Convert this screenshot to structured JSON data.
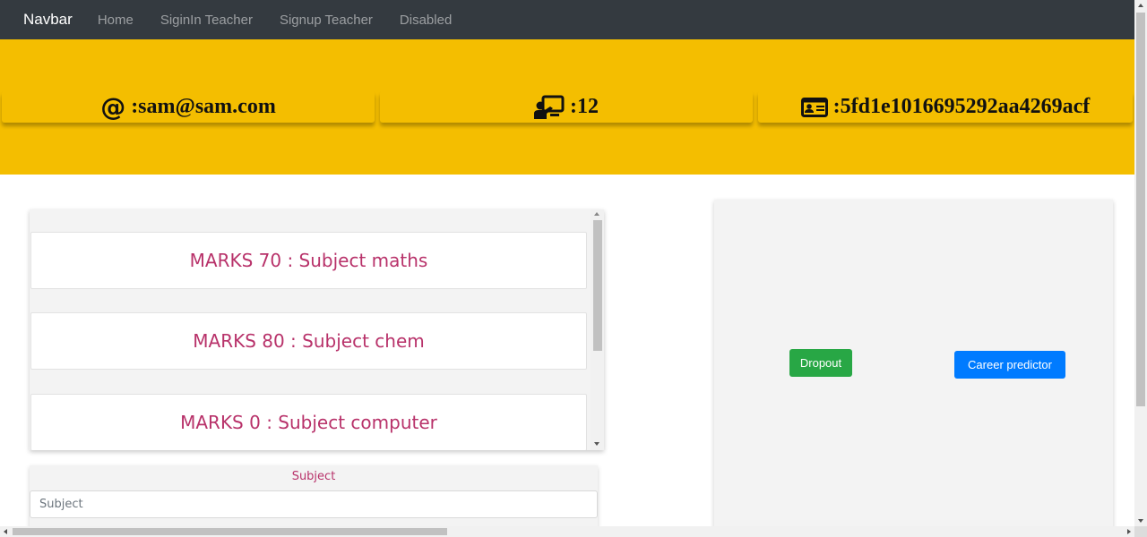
{
  "navbar": {
    "brand": "Navbar",
    "links": [
      "Home",
      "SiginIn Teacher",
      "Signup Teacher",
      "Disabled"
    ]
  },
  "profile": {
    "email": ":sam@sam.com",
    "email_icon": "at-sign-icon",
    "count": ":12",
    "count_icon": "chalkboard-teacher-icon",
    "id": ":5fd1e1016695292aa4269acf",
    "id_icon": "id-card-icon"
  },
  "marks": [
    {
      "text": "MARKS 70 : Subject maths"
    },
    {
      "text": "MARKS 80 : Subject chem"
    },
    {
      "text": "MARKS 0 : Subject computer"
    }
  ],
  "subject_form": {
    "label": "Subject",
    "placeholder": "Subject"
  },
  "actions": {
    "dropout": "Dropout",
    "career": "Career predictor"
  },
  "colors": {
    "navbar": "#343a40",
    "hero": "#f4be00",
    "marks_text": "#b8326a",
    "dropout_button": "#28a745",
    "career_button": "#007bff"
  }
}
